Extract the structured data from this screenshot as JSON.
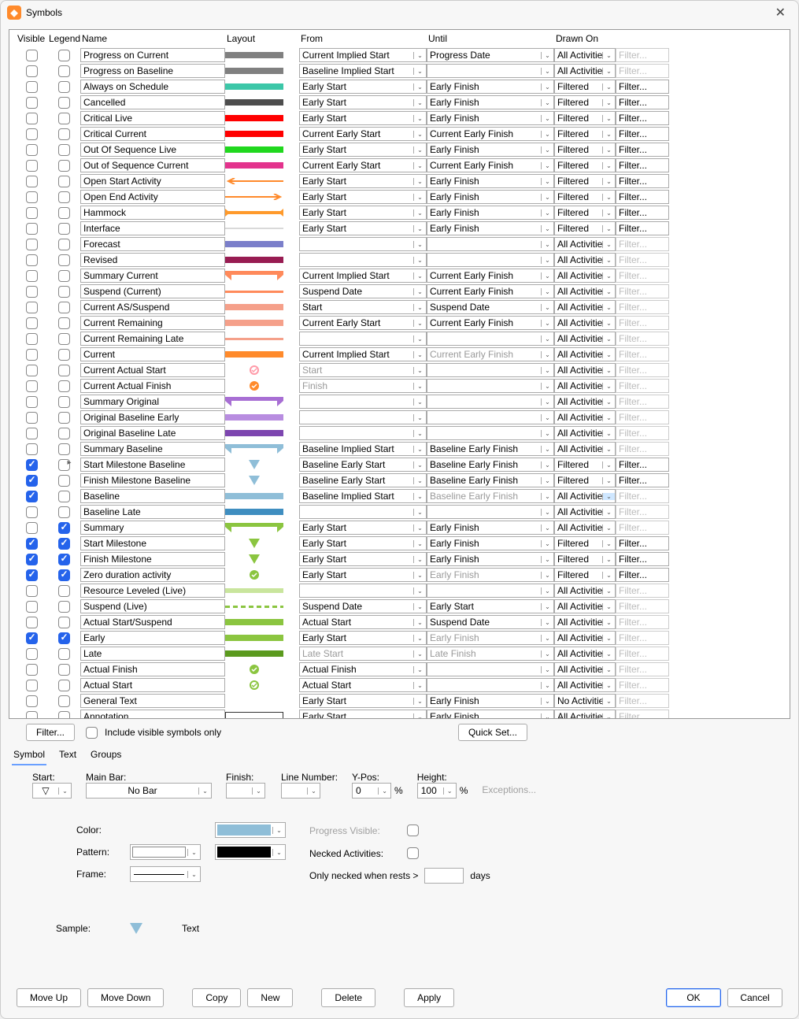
{
  "window": {
    "title": "Symbols"
  },
  "headers": {
    "visible": "Visible",
    "legend": "Legend",
    "name": "Name",
    "layout": "Layout",
    "from": "From",
    "until": "Until",
    "drawnon": "Drawn On"
  },
  "rows": [
    {
      "vis": false,
      "leg": false,
      "name": "Progress on Current",
      "sw": {
        "type": "bar",
        "h": 8,
        "c": "#808080"
      },
      "from": "Current Implied Start",
      "until": "Progress Date",
      "drawn": "All Activities",
      "filtAct": false
    },
    {
      "vis": false,
      "leg": false,
      "name": "Progress on Baseline",
      "sw": {
        "type": "bar",
        "h": 8,
        "c": "#808080"
      },
      "from": "Baseline Implied Start",
      "until": "",
      "drawn": "All Activities",
      "filtAct": false
    },
    {
      "vis": false,
      "leg": false,
      "name": "Always on Schedule",
      "sw": {
        "type": "bar",
        "h": 8,
        "c": "#3cc7a8"
      },
      "from": "Early Start",
      "until": "Early Finish",
      "drawn": "Filtered",
      "filtAct": true
    },
    {
      "vis": false,
      "leg": false,
      "name": "Cancelled",
      "sw": {
        "type": "bar",
        "h": 8,
        "c": "#4d4d4d"
      },
      "from": "Early Start",
      "until": "Early Finish",
      "drawn": "Filtered",
      "filtAct": true
    },
    {
      "vis": false,
      "leg": false,
      "name": "Critical Live",
      "sw": {
        "type": "bar",
        "h": 8,
        "c": "#ff0000"
      },
      "from": "Early Start",
      "until": "Early Finish",
      "drawn": "Filtered",
      "filtAct": true
    },
    {
      "vis": false,
      "leg": false,
      "name": "Critical Current",
      "sw": {
        "type": "bar",
        "h": 8,
        "c": "#ff0000"
      },
      "from": "Current Early Start",
      "until": "Current Early Finish",
      "drawn": "Filtered",
      "filtAct": true
    },
    {
      "vis": false,
      "leg": false,
      "name": "Out Of Sequence Live",
      "sw": {
        "type": "bar",
        "h": 8,
        "c": "#20d81e"
      },
      "from": "Early Start",
      "until": "Early Finish",
      "drawn": "Filtered",
      "filtAct": true
    },
    {
      "vis": false,
      "leg": false,
      "name": "Out of Sequence Current",
      "sw": {
        "type": "bar",
        "h": 8,
        "c": "#e3338d"
      },
      "from": "Current Early Start",
      "until": "Current Early Finish",
      "drawn": "Filtered",
      "filtAct": true
    },
    {
      "vis": false,
      "leg": false,
      "name": "Open Start Activity",
      "sw": {
        "type": "openstart",
        "c": "#ff8a2b"
      },
      "from": "Early Start",
      "until": "Early Finish",
      "drawn": "Filtered",
      "filtAct": true
    },
    {
      "vis": false,
      "leg": false,
      "name": "Open End Activity",
      "sw": {
        "type": "openend",
        "c": "#ff8a2b"
      },
      "from": "Early Start",
      "until": "Early Finish",
      "drawn": "Filtered",
      "filtAct": true
    },
    {
      "vis": false,
      "leg": false,
      "name": "Hammock",
      "sw": {
        "type": "hammock",
        "c": "#ff9a2b"
      },
      "from": "Early Start",
      "until": "Early Finish",
      "drawn": "Filtered",
      "filtAct": true
    },
    {
      "vis": false,
      "leg": false,
      "name": "Interface",
      "sw": {
        "type": "line",
        "h": 2,
        "c": "#d9d9d9"
      },
      "from": "Early Start",
      "until": "Early Finish",
      "drawn": "Filtered",
      "filtAct": true
    },
    {
      "vis": false,
      "leg": false,
      "name": "Forecast",
      "sw": {
        "type": "bar",
        "h": 8,
        "c": "#7b7fca"
      },
      "from": "",
      "until": "",
      "drawn": "All Activities",
      "filtAct": false
    },
    {
      "vis": false,
      "leg": false,
      "name": "Revised",
      "sw": {
        "type": "bar",
        "h": 8,
        "c": "#981c52"
      },
      "from": "",
      "until": "",
      "drawn": "All Activities",
      "filtAct": false
    },
    {
      "vis": false,
      "leg": false,
      "name": "Summary Current",
      "sw": {
        "type": "summary",
        "c": "#ff8a5b"
      },
      "from": "Current Implied Start",
      "until": "Current Early Finish",
      "drawn": "All Activities",
      "filtAct": false
    },
    {
      "vis": false,
      "leg": false,
      "name": "Suspend (Current)",
      "sw": {
        "type": "line",
        "h": 3,
        "c": "#ff8a5b"
      },
      "from": "Suspend Date",
      "until": "Current Early Finish",
      "drawn": "All Activities",
      "filtAct": false
    },
    {
      "vis": false,
      "leg": false,
      "name": "Current AS/Suspend",
      "sw": {
        "type": "bar",
        "h": 8,
        "c": "#f5a08a"
      },
      "from": "Start",
      "until": "Suspend Date",
      "drawn": "All Activities",
      "filtAct": false
    },
    {
      "vis": false,
      "leg": false,
      "name": "Current Remaining",
      "sw": {
        "type": "bar",
        "h": 8,
        "c": "#f5a08a"
      },
      "from": "Current Early Start",
      "until": "Current Early Finish",
      "drawn": "All Activities",
      "filtAct": false
    },
    {
      "vis": false,
      "leg": false,
      "name": "Current Remaining Late",
      "sw": {
        "type": "line",
        "h": 3,
        "c": "#f5a08a"
      },
      "from": "",
      "until": "",
      "drawn": "All Activities",
      "filtAct": false
    },
    {
      "vis": false,
      "leg": false,
      "name": "Current",
      "sw": {
        "type": "bar",
        "h": 8,
        "c": "#ff8a2b"
      },
      "from": "Current Implied Start",
      "until": "Current Early Finish",
      "untilDis": true,
      "drawn": "All Activities",
      "filtAct": false
    },
    {
      "vis": false,
      "leg": false,
      "name": "Current Actual Start",
      "sw": {
        "type": "circ",
        "c": "#ff9aa8"
      },
      "from": "Start",
      "fromDis": true,
      "until": "",
      "drawn": "All Activities",
      "filtAct": false
    },
    {
      "vis": false,
      "leg": false,
      "name": "Current Actual Finish",
      "sw": {
        "type": "circfill",
        "c": "#ff8a2b"
      },
      "from": "Finish",
      "fromDis": true,
      "until": "",
      "drawn": "All Activities",
      "filtAct": false
    },
    {
      "vis": false,
      "leg": false,
      "name": "Summary Original",
      "sw": {
        "type": "summary",
        "c": "#a86fd4"
      },
      "from": "",
      "until": "",
      "drawn": "All Activities",
      "filtAct": false
    },
    {
      "vis": false,
      "leg": false,
      "name": "Original Baseline Early",
      "sw": {
        "type": "bar",
        "h": 8,
        "c": "#b88de0"
      },
      "from": "",
      "until": "",
      "drawn": "All Activities",
      "filtAct": false
    },
    {
      "vis": false,
      "leg": false,
      "name": "Original Baseline Late",
      "sw": {
        "type": "bar",
        "h": 8,
        "c": "#7d46b0"
      },
      "from": "",
      "until": "",
      "drawn": "All Activities",
      "filtAct": false
    },
    {
      "vis": false,
      "leg": false,
      "name": "Summary Baseline",
      "sw": {
        "type": "summary",
        "c": "#8fbed8"
      },
      "from": "Baseline Implied Start",
      "until": "Baseline Early Finish",
      "drawn": "All Activities",
      "filtAct": false
    },
    {
      "vis": true,
      "leg": false,
      "name": "Start Milestone Baseline",
      "sw": {
        "type": "tri",
        "c": "#8fbed8"
      },
      "from": "Baseline Early Start",
      "until": "Baseline Early Finish",
      "drawn": "Filtered",
      "filtAct": true,
      "mark": true
    },
    {
      "vis": true,
      "leg": false,
      "name": "Finish Milestone Baseline",
      "sw": {
        "type": "tri",
        "c": "#8fbed8"
      },
      "from": "Baseline Early Start",
      "until": "Baseline Early Finish",
      "drawn": "Filtered",
      "filtAct": true
    },
    {
      "vis": true,
      "leg": false,
      "name": "Baseline",
      "sw": {
        "type": "bar",
        "h": 8,
        "c": "#8fbed8"
      },
      "from": "Baseline Implied Start",
      "until": "Baseline Early Finish",
      "untilDis": true,
      "drawn": "All Activities",
      "drawnHl": true,
      "filtAct": false
    },
    {
      "vis": false,
      "leg": false,
      "name": "Baseline Late",
      "sw": {
        "type": "bar",
        "h": 8,
        "c": "#3f8ec0"
      },
      "from": "",
      "until": "",
      "drawn": "All Activities",
      "filtAct": false
    },
    {
      "vis": false,
      "leg": true,
      "name": "Summary",
      "sw": {
        "type": "summary",
        "c": "#8bc540"
      },
      "from": "Early Start",
      "until": "Early Finish",
      "drawn": "All Activities",
      "filtAct": false
    },
    {
      "vis": true,
      "leg": true,
      "name": "Start Milestone",
      "sw": {
        "type": "tri",
        "c": "#8bc540"
      },
      "from": "Early Start",
      "until": "Early Finish",
      "drawn": "Filtered",
      "filtAct": true
    },
    {
      "vis": true,
      "leg": true,
      "name": "Finish Milestone",
      "sw": {
        "type": "tri",
        "c": "#8bc540"
      },
      "from": "Early Start",
      "until": "Early Finish",
      "drawn": "Filtered",
      "filtAct": true
    },
    {
      "vis": true,
      "leg": true,
      "name": "Zero duration activity",
      "sw": {
        "type": "circfill",
        "c": "#8bc540"
      },
      "from": "Early Start",
      "until": "Early Finish",
      "untilDis": true,
      "drawn": "Filtered",
      "filtAct": true
    },
    {
      "vis": false,
      "leg": false,
      "name": "Resource Leveled (Live)",
      "sw": {
        "type": "bar",
        "h": 6,
        "c": "#c9e59d"
      },
      "from": "",
      "until": "",
      "drawn": "All Activities",
      "filtAct": false
    },
    {
      "vis": false,
      "leg": false,
      "name": "Suspend (Live)",
      "sw": {
        "type": "dash",
        "c": "#8bc540"
      },
      "from": "Suspend Date",
      "until": "Early Start",
      "drawn": "All Activities",
      "filtAct": false
    },
    {
      "vis": false,
      "leg": false,
      "name": "Actual Start/Suspend",
      "sw": {
        "type": "bar",
        "h": 8,
        "c": "#8bc540"
      },
      "from": "Actual Start",
      "until": "Suspend Date",
      "drawn": "All Activities",
      "filtAct": false
    },
    {
      "vis": true,
      "leg": true,
      "name": "Early",
      "sw": {
        "type": "bar",
        "h": 8,
        "c": "#8bc540"
      },
      "from": "Early Start",
      "until": "Early Finish",
      "untilDis": true,
      "drawn": "All Activities",
      "filtAct": false
    },
    {
      "vis": false,
      "leg": false,
      "name": "Late",
      "sw": {
        "type": "bar",
        "h": 8,
        "c": "#5b9a1e"
      },
      "from": "Late Start",
      "fromDis": true,
      "until": "Late Finish",
      "untilDis": true,
      "drawn": "All Activities",
      "filtAct": false
    },
    {
      "vis": false,
      "leg": false,
      "name": "Actual Finish",
      "sw": {
        "type": "circfill",
        "c": "#8bc540"
      },
      "from": "Actual Finish",
      "until": "",
      "drawn": "All Activities",
      "filtAct": false
    },
    {
      "vis": false,
      "leg": false,
      "name": "Actual Start",
      "sw": {
        "type": "circ",
        "c": "#8bc540"
      },
      "from": "Actual Start",
      "until": "",
      "drawn": "All Activities",
      "filtAct": false
    },
    {
      "vis": false,
      "leg": false,
      "name": "General Text",
      "sw": {
        "type": "none"
      },
      "from": "Early Start",
      "until": "Early Finish",
      "drawn": "No Activities",
      "filtAct": false
    },
    {
      "vis": false,
      "leg": false,
      "name": "Annotation",
      "sw": {
        "type": "box"
      },
      "from": "Early Start",
      "until": "Early Finish",
      "drawn": "All Activities",
      "filtAct": false
    }
  ],
  "filterStrip": {
    "filterBtn": "Filter...",
    "includeVisible": "Include visible symbols only",
    "quickSet": "Quick Set..."
  },
  "tabs": {
    "symbol": "Symbol",
    "text": "Text",
    "groups": "Groups"
  },
  "panel": {
    "startLbl": "Start:",
    "mainBarLbl": "Main Bar:",
    "finishLbl": "Finish:",
    "mainBarVal": "No Bar",
    "colorLbl": "Color:",
    "patternLbl": "Pattern:",
    "frameLbl": "Frame:",
    "lineNumLbl": "Line Number:",
    "yposLbl": "Y-Pos:",
    "heightLbl": "Height:",
    "yposVal": "0",
    "heightVal": "100",
    "pct": "%",
    "exceptions": "Exceptions...",
    "progressVisible": "Progress Visible:",
    "neckedActivities": "Necked Activities:",
    "onlyNecked": "Only necked when rests >",
    "days": "days",
    "sampleLbl": "Sample:",
    "sampleText": "Text"
  },
  "footer": {
    "moveUp": "Move Up",
    "moveDown": "Move Down",
    "copy": "Copy",
    "new": "New",
    "delete": "Delete",
    "apply": "Apply",
    "ok": "OK",
    "cancel": "Cancel"
  },
  "filterPlaceholder": "Filter..."
}
